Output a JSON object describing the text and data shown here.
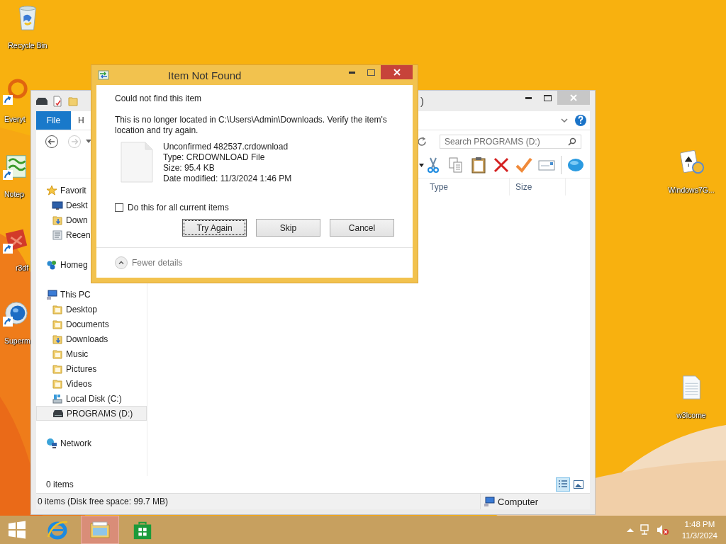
{
  "desktop_icons": [
    {
      "label": "Recycle Bin",
      "kind": "recycle",
      "shortcut": false
    },
    {
      "label": "Everyt",
      "kind": "ring",
      "shortcut": true
    },
    {
      "label": "Notep",
      "kind": "notepad",
      "shortcut": true
    },
    {
      "label": "r3df",
      "kind": "red",
      "shortcut": true
    },
    {
      "label": "Superm",
      "kind": "globe",
      "shortcut": true
    },
    {
      "label": "Windows7G...",
      "kind": "cards",
      "shortcut": false
    },
    {
      "label": "w3lcome",
      "kind": "textfile",
      "shortcut": false
    }
  ],
  "explorer": {
    "title": ")",
    "ribbon_tabs": [
      {
        "label": "File",
        "kind": "file"
      },
      {
        "label": "H",
        "kind": "tab"
      }
    ],
    "search": {
      "placeholder": "Search PROGRAMS (D:)"
    },
    "columns": [
      "Type",
      "Size"
    ],
    "nav_pane": [
      {
        "label": "Favorit",
        "kind": "star",
        "selected": false,
        "children": [
          {
            "label": "Deskt",
            "kind": "monitor",
            "selected": false
          },
          {
            "label": "Down",
            "kind": "download",
            "selected": false
          },
          {
            "label": "Recen",
            "kind": "recent",
            "selected": false
          }
        ]
      },
      {
        "label": "Homeg",
        "kind": "homegroup",
        "selected": false
      },
      {
        "label": "This PC",
        "kind": "computer",
        "selected": false,
        "children": [
          {
            "label": "Desktop",
            "kind": "folder",
            "selected": false
          },
          {
            "label": "Documents",
            "kind": "folder",
            "selected": false
          },
          {
            "label": "Downloads",
            "kind": "download",
            "selected": false
          },
          {
            "label": "Music",
            "kind": "folder",
            "selected": false
          },
          {
            "label": "Pictures",
            "kind": "folder",
            "selected": false
          },
          {
            "label": "Videos",
            "kind": "folder",
            "selected": false
          },
          {
            "label": "Local Disk (C:)",
            "kind": "disk",
            "selected": false
          },
          {
            "label": "PROGRAMS (D:)",
            "kind": "drive",
            "selected": true
          }
        ]
      },
      {
        "label": "Network",
        "kind": "network",
        "selected": false
      }
    ],
    "item_count": "0 items",
    "view_buttons": [
      {
        "kind": "details",
        "selected": true
      },
      {
        "kind": "large",
        "selected": false
      }
    ],
    "status_text": "0 items (Disk free space: 99.7 MB)",
    "status_location": "Computer"
  },
  "dialog": {
    "title": "Item Not Found",
    "heading": "Could not find this item",
    "message": "This is no longer located in C:\\Users\\Admin\\Downloads. Verify the item's location and try again.",
    "file_details": [
      "Unconfirmed 482537.crdownload",
      "Type: CRDOWNLOAD File",
      "Size: 95.4 KB",
      "Date modified: 11/3/2024 1:46 PM"
    ],
    "checkbox": {
      "label": "Do this for all current items",
      "checked": false
    },
    "buttons": [
      {
        "label": "Try Again",
        "focused": true
      },
      {
        "label": "Skip",
        "focused": false
      },
      {
        "label": "Cancel",
        "focused": false
      }
    ],
    "details_toggle": "Fewer details"
  },
  "taskbar": {
    "apps": [
      {
        "kind": "ie",
        "active": false
      },
      {
        "kind": "explorer",
        "active": true
      },
      {
        "kind": "store",
        "active": false
      }
    ],
    "time": "1:48 PM",
    "date": "11/3/2024"
  }
}
